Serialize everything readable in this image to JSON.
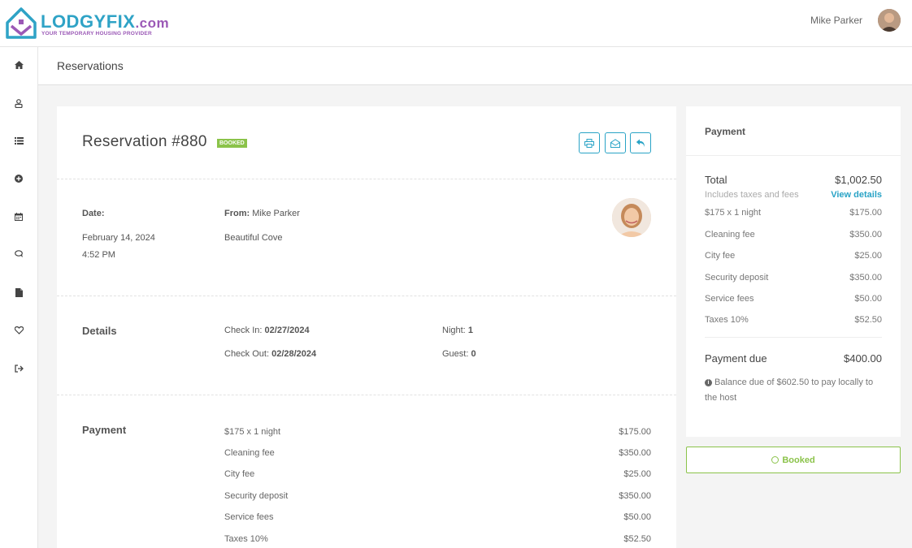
{
  "brand": {
    "name": "LODGYFIX",
    "suffix": ".com",
    "tagline": "YOUR TEMPORARY HOUSING PROVIDER"
  },
  "user": {
    "name": "Mike Parker"
  },
  "sidebar": {
    "items": [
      {
        "icon": "home-icon"
      },
      {
        "icon": "user-icon"
      },
      {
        "icon": "list-icon"
      },
      {
        "icon": "plus-circle-icon"
      },
      {
        "icon": "calendar-icon"
      },
      {
        "icon": "chat-icon"
      },
      {
        "icon": "file-icon"
      },
      {
        "icon": "heart-icon"
      },
      {
        "icon": "logout-icon"
      }
    ]
  },
  "page": {
    "title": "Reservations"
  },
  "reservation": {
    "title": "Reservation #880",
    "badge": "BOOKED",
    "date_label": "Date:",
    "date": "February 14, 2024",
    "time": "4:52 PM",
    "from_label": "From:",
    "from_name": "Mike Parker",
    "property": "Beautiful Cove",
    "details_title": "Details",
    "check_in_label": "Check In:",
    "check_in": "02/27/2024",
    "check_out_label": "Check Out:",
    "check_out": "02/28/2024",
    "night_label": "Night:",
    "night": "1",
    "guest_label": "Guest:",
    "guest": "0",
    "payment_title": "Payment",
    "payment_items": [
      {
        "label": "$175 x 1 night",
        "value": "$175.00"
      },
      {
        "label": "Cleaning fee",
        "value": "$350.00"
      },
      {
        "label": "City fee",
        "value": "$25.00"
      },
      {
        "label": "Security deposit",
        "value": "$350.00"
      },
      {
        "label": "Service fees",
        "value": "$50.00"
      },
      {
        "label": "Taxes 10%",
        "value": "$52.50"
      }
    ]
  },
  "summary": {
    "title": "Payment",
    "total_label": "Total",
    "total_value": "$1,002.50",
    "includes": "Includes taxes and fees",
    "view_details": "View details",
    "items": [
      {
        "label": "$175 x 1 night",
        "value": "$175.00"
      },
      {
        "label": "Cleaning fee",
        "value": "$350.00"
      },
      {
        "label": "City fee",
        "value": "$25.00"
      },
      {
        "label": "Security deposit",
        "value": "$350.00"
      },
      {
        "label": "Service fees",
        "value": "$50.00"
      },
      {
        "label": "Taxes 10%",
        "value": "$52.50"
      }
    ],
    "due_label": "Payment due",
    "due_value": "$400.00",
    "note": "Balance due of $602.50 to pay locally to the host",
    "status_button": "Booked"
  },
  "colors": {
    "accent": "#29a3c6",
    "brand_purple": "#9b59b6",
    "success": "#8bc34a"
  }
}
